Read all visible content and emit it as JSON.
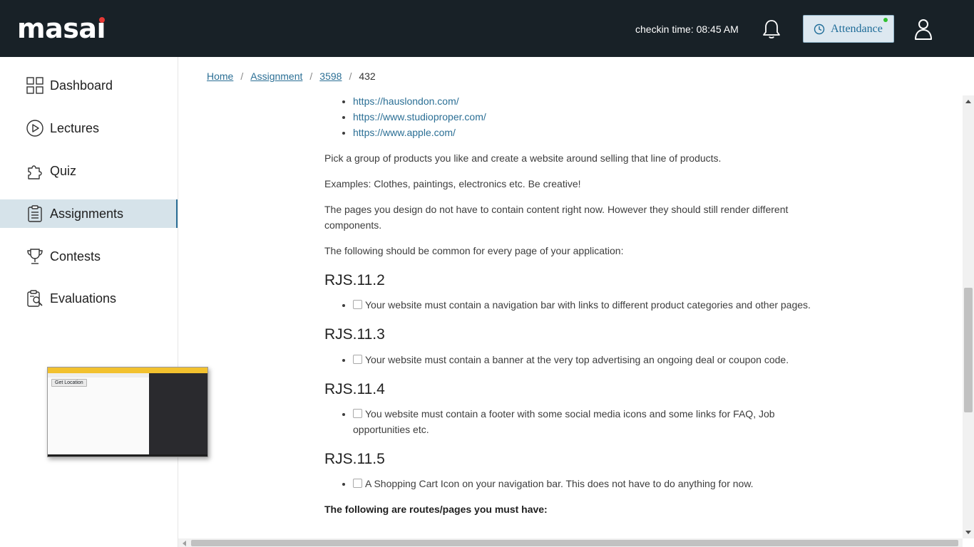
{
  "header": {
    "logo_text": "masai",
    "checkin_text": "checkin time: 08:45 AM",
    "attendance_label": "Attendance",
    "bell_icon": "bell-icon",
    "user_icon": "user-icon",
    "brand_color": "#182127",
    "accent_red": "#e53935",
    "status_green": "#2ec02e"
  },
  "sidebar": {
    "items": [
      {
        "label": "Dashboard",
        "icon": "grid-icon",
        "active": false
      },
      {
        "label": "Lectures",
        "icon": "play-circle-icon",
        "active": false
      },
      {
        "label": "Quiz",
        "icon": "puzzle-icon",
        "active": false
      },
      {
        "label": "Assignments",
        "icon": "clipboard-icon",
        "active": true
      },
      {
        "label": "Contests",
        "icon": "trophy-icon",
        "active": false
      },
      {
        "label": "Evaluations",
        "icon": "evaluation-icon",
        "active": false
      }
    ],
    "thumbnail": {
      "button_label": "Get Location"
    }
  },
  "breadcrumb": {
    "items": [
      "Home",
      "Assignment",
      "3598"
    ],
    "current": "432"
  },
  "content": {
    "links": [
      "https://hauslondon.com/",
      "https://www.studioproper.com/",
      "https://www.apple.com/"
    ],
    "para1": "Pick a group of products you like and create a website around selling that line of products.",
    "para2": "Examples: Clothes, paintings, electronics etc. Be creative!",
    "para3": "The pages you design do not have to contain content right now. However they should still render different components.",
    "para4": "The following should be common for every page of your application:",
    "sections": [
      {
        "id": "RJS.11.2",
        "task": "Your website must contain a navigation bar with links to different product categories and other pages."
      },
      {
        "id": "RJS.11.3",
        "task": "Your website must contain a banner at the very top advertising an ongoing deal or coupon code."
      },
      {
        "id": "RJS.11.4",
        "task": "You website must contain a footer with some social media icons and some links for FAQ, Job opportunities etc."
      },
      {
        "id": "RJS.11.5",
        "task": "A Shopping Cart Icon on your navigation bar. This does not have to do anything for now."
      }
    ],
    "routes_heading": "The following are routes/pages you must have:"
  }
}
